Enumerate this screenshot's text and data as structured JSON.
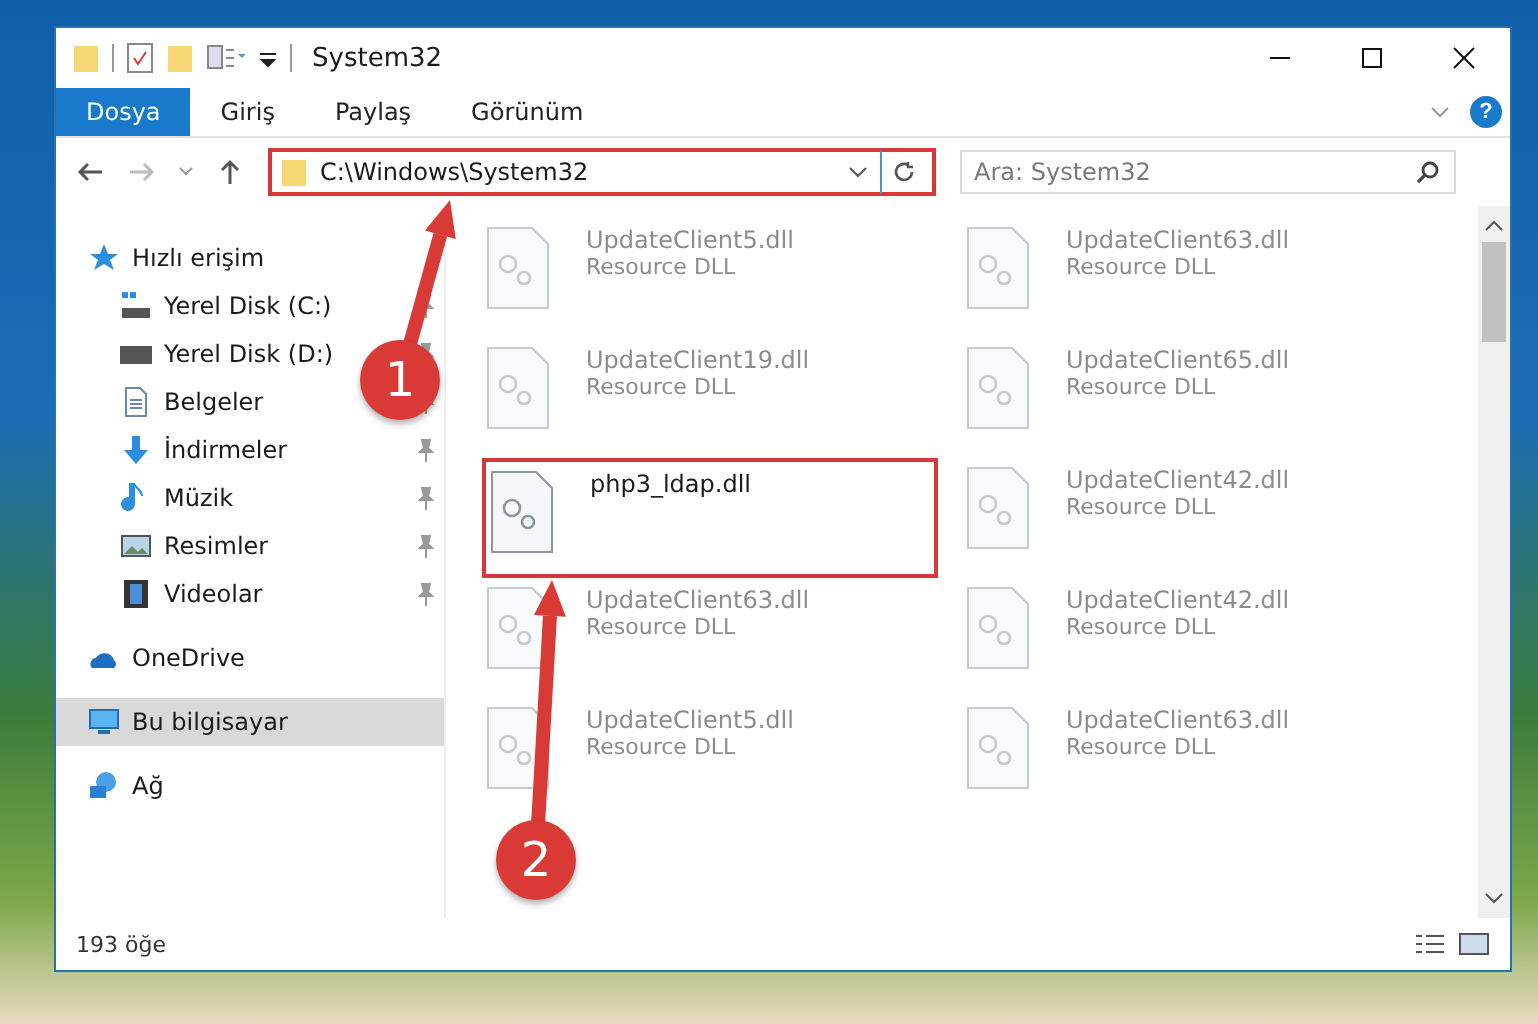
{
  "window": {
    "title": "System32",
    "help": "?"
  },
  "ribbon_tabs": [
    {
      "label": "Dosya",
      "selected": true
    },
    {
      "label": "Giriş",
      "selected": false
    },
    {
      "label": "Paylaş",
      "selected": false
    },
    {
      "label": "Görünüm",
      "selected": false
    }
  ],
  "address_bar": {
    "path": "C:\\Windows\\System32",
    "highlighted": true
  },
  "search": {
    "placeholder": "Ara: System32"
  },
  "sidebar": {
    "items": [
      {
        "label": "Hızlı erişim",
        "kind": "star",
        "selected": false,
        "children": [
          {
            "label": "Yerel Disk (C:)",
            "kind": "system",
            "pinned": true,
            "selected": false
          },
          {
            "label": "Yerel Disk (D:)",
            "kind": "drive",
            "pinned": true,
            "selected": false
          },
          {
            "label": "Belgeler",
            "kind": "document",
            "pinned": true,
            "selected": false
          },
          {
            "label": "İndirmeler",
            "kind": "download",
            "pinned": true,
            "selected": false
          },
          {
            "label": "Müzik",
            "kind": "music",
            "pinned": true,
            "selected": false
          },
          {
            "label": "Resimler",
            "kind": "picture",
            "pinned": true,
            "selected": false
          },
          {
            "label": "Videolar",
            "kind": "video",
            "pinned": true,
            "selected": false
          }
        ]
      },
      {
        "label": "OneDrive",
        "kind": "cloud",
        "selected": false
      },
      {
        "label": "Bu bilgisayar",
        "kind": "computer",
        "selected": true
      },
      {
        "label": "Ağ",
        "kind": "network",
        "selected": false
      }
    ]
  },
  "files": [
    {
      "name": "UpdateClient5.dll",
      "type": "Resource DLL",
      "highlighted": false
    },
    {
      "name": "UpdateClient63.dll",
      "type": "Resource DLL",
      "highlighted": false
    },
    {
      "name": "UpdateClient19.dll",
      "type": "Resource DLL",
      "highlighted": false
    },
    {
      "name": "UpdateClient65.dll",
      "type": "Resource DLL",
      "highlighted": false
    },
    {
      "name": "php3_ldap.dll",
      "highlighted": true
    },
    {
      "name": "UpdateClient42.dll",
      "type": "Resource DLL",
      "highlighted": false
    },
    {
      "name": "UpdateClient63.dll",
      "type": "Resource DLL",
      "highlighted": false
    },
    {
      "name": "UpdateClient42.dll",
      "type": "Resource DLL",
      "highlighted": false
    },
    {
      "name": "UpdateClient5.dll",
      "type": "Resource DLL",
      "highlighted": false
    },
    {
      "name": "UpdateClient63.dll",
      "type": "Resource DLL",
      "highlighted": false
    }
  ],
  "status_bar": {
    "item_count": "193 öğe"
  },
  "annotations": [
    {
      "number": "1"
    },
    {
      "number": "2"
    }
  ]
}
